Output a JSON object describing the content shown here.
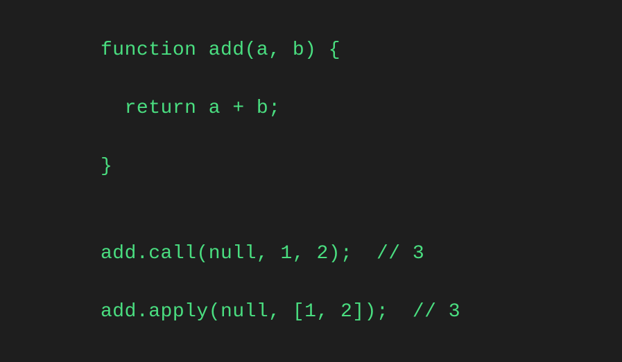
{
  "code": {
    "line1": "function add(a, b) {",
    "line2": "  return a + b;",
    "line3": "}",
    "line4": "",
    "line5": "add.call(null, 1, 2);  // 3",
    "line6": "add.apply(null, [1, 2]);  // 3"
  }
}
